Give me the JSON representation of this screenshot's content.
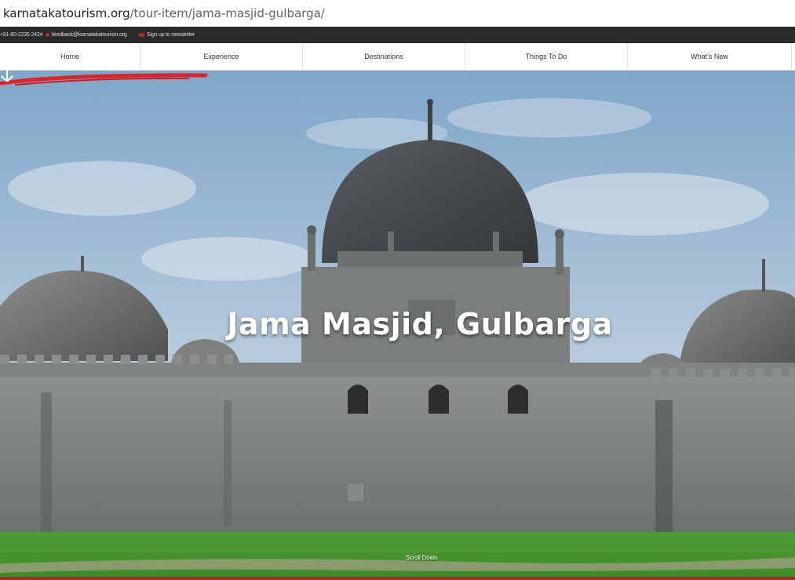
{
  "browser": {
    "url_domain": "karnatakatourism.org",
    "url_path": "/tour-item/jama-masjid-gulbarga/"
  },
  "topbar": {
    "phone": "+91-80-2235 2424",
    "email": "feedback@karnatakatourism.org",
    "newsletter": "Sign up to newsletter",
    "accent": "#b8252a"
  },
  "nav": {
    "items": [
      "Home",
      "Experience",
      "Destinations",
      "Things To Do",
      "What's New"
    ]
  },
  "hero": {
    "title": "Jama Masjid, Gulbarga",
    "scroll_label": "Scroll Down",
    "underline_color": "#d8262b"
  },
  "icons": [
    "phone-icon",
    "mail-icon",
    "newsletter-icon",
    "scroll-down-icon"
  ]
}
